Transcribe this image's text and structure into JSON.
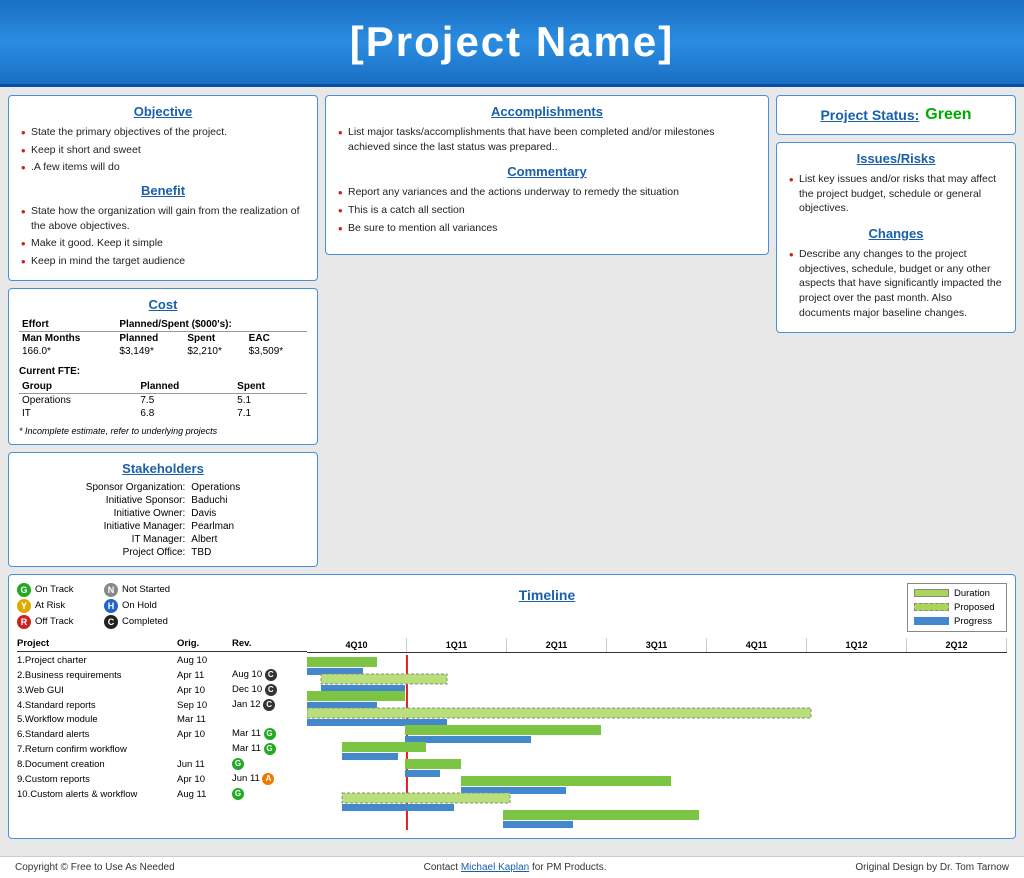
{
  "header": {
    "title": "[Project Name]"
  },
  "objective": {
    "title": "Objective",
    "bullets": [
      "State the primary objectives of the project.",
      "Keep it short and sweet",
      ".A few items will do"
    ],
    "benefit_title": "Benefit",
    "benefit_bullets": [
      "State how the organization will gain from the realization of the above  objectives.",
      "Make it good. Keep it simple",
      "Keep in mind the target audience"
    ]
  },
  "accomplishments": {
    "title": "Accomplishments",
    "bullets": [
      "List major tasks/accomplishments that have  been completed and/or milestones achieved  since the last status was prepared.."
    ],
    "commentary_title": "Commentary",
    "commentary_bullets": [
      "Report any variances  and the actions underway to remedy the situation",
      "This is a catch all section",
      "Be  sure to mention all variances"
    ]
  },
  "project_status": {
    "title": "Project Status:",
    "status": "Green"
  },
  "issues_risks": {
    "title": "Issues/Risks",
    "bullets": [
      "List key issues and/or risks that may affect the project budget, schedule or general objectives."
    ]
  },
  "changes": {
    "title": "Changes",
    "bullets": [
      "Describe any changes to the project objectives, schedule, budget or any other aspects that have significantly impacted the project over the past month. Also documents major baseline changes."
    ]
  },
  "cost": {
    "title": "Cost",
    "effort_label": "Effort",
    "planned_spent_label": "Planned/Spent ($000's):",
    "man_months_label": "Man Months",
    "planned_label": "Planned",
    "spent_label": "Spent",
    "eac_label": "EAC",
    "man_months_value": "166.0*",
    "planned_value": "$3,149*",
    "spent_value": "$2,210*",
    "eac_value": "$3,509*",
    "current_fte_label": "Current FTE:",
    "group_label": "Group",
    "fte_planned_label": "Planned",
    "fte_spent_label": "Spent",
    "fte_rows": [
      {
        "group": "Operations",
        "planned": "7.5",
        "spent": "5.1"
      },
      {
        "group": "IT",
        "planned": "6.8",
        "spent": "7.1"
      }
    ],
    "footnote": "* Incomplete estimate, refer to underlying projects"
  },
  "stakeholders": {
    "title": "Stakeholders",
    "rows": [
      {
        "label": "Sponsor Organization:",
        "value": "Operations"
      },
      {
        "label": "Initiative Sponsor:",
        "value": "Baduchi"
      },
      {
        "label": "Initiative Owner:",
        "value": "Davis"
      },
      {
        "label": "Initiative Manager:",
        "value": "Pearlman"
      },
      {
        "label": "IT Manager:",
        "value": "Albert"
      },
      {
        "label": "Project Office:",
        "value": "TBD"
      }
    ]
  },
  "timeline": {
    "title": "Timeline",
    "legend_left": [
      {
        "circle": "G",
        "color": "green",
        "label": "On Track",
        "circle2": "N",
        "color2": "gray",
        "label2": "Not Started"
      },
      {
        "circle": "Y",
        "color": "yellow",
        "label": "At Risk",
        "circle2": "H",
        "color2": "blue",
        "label2": "On Hold"
      },
      {
        "circle": "R",
        "color": "red",
        "label": "Off Track",
        "circle2": "C",
        "color2": "dark",
        "label2": "Completed"
      }
    ],
    "legend_right": [
      {
        "bar": "duration",
        "label": "Duration"
      },
      {
        "bar": "proposed",
        "label": "Proposed"
      },
      {
        "bar": "progress",
        "label": "Progress"
      }
    ],
    "columns": [
      "Project",
      "Orig.",
      "Rev."
    ],
    "quarters": [
      "4Q10",
      "1Q11",
      "2Q11",
      "3Q11",
      "4Q11",
      "1Q12",
      "2Q12"
    ],
    "projects": [
      {
        "name": "1.Project charter",
        "orig": "Aug 10",
        "rev": "",
        "dot": "",
        "bars": []
      },
      {
        "name": "2.Business requirements",
        "orig": "Apr 11",
        "rev": "Aug 10",
        "dot": "C",
        "dot_color": "dark",
        "bars": []
      },
      {
        "name": "3.Web GUI",
        "orig": "Apr 10",
        "rev": "Dec 10",
        "dot": "C",
        "dot_color": "dark",
        "bars": []
      },
      {
        "name": "4.Standard reports",
        "orig": "Sep 10",
        "rev": "Jan 12",
        "dot": "C",
        "dot_color": "dark",
        "bars": []
      },
      {
        "name": "5.Workflow module",
        "orig": "Mar 11",
        "rev": "",
        "dot": "",
        "bars": []
      },
      {
        "name": "6.Standard alerts",
        "orig": "Apr 10",
        "rev": "Mar 11",
        "dot": "G",
        "dot_color": "green",
        "bars": []
      },
      {
        "name": "7.Return confirm workflow",
        "orig": "",
        "rev": "Mar 11",
        "dot": "G",
        "dot_color": "green",
        "bars": []
      },
      {
        "name": "8.Document creation",
        "orig": "Jun 11",
        "rev": "",
        "dot": "G",
        "dot_color": "green",
        "bars": []
      },
      {
        "name": "9.Custom reports",
        "orig": "Apr 10",
        "rev": "Jun 11",
        "dot": "A",
        "dot_color": "orange",
        "bars": []
      },
      {
        "name": "10.Custom alerts & workflow",
        "orig": "Aug 11",
        "rev": "",
        "dot": "G",
        "dot_color": "green",
        "bars": []
      }
    ]
  },
  "footer": {
    "copyright": "Copyright © Free to  Use As Needed",
    "contact_text": "Contact",
    "contact_link": "Michael Kaplan",
    "contact_suffix": " for PM Products.",
    "original_design": "Original Design by Dr. Tom Tarnow"
  }
}
